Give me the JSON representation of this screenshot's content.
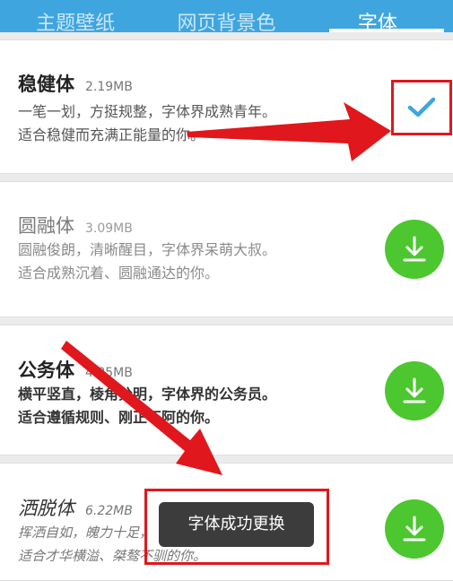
{
  "tabs": [
    {
      "label": "主题壁纸",
      "active": false
    },
    {
      "label": "网页背景色",
      "active": false
    },
    {
      "label": "字体",
      "active": true
    }
  ],
  "fonts": [
    {
      "name": "稳健体",
      "size": "2.19MB",
      "desc1": "一笔一划，方挺规整，字体界成熟青年。",
      "desc2": "适合稳健而充满正能量的你。",
      "status": "selected"
    },
    {
      "name": "圆融体",
      "size": "3.09MB",
      "desc1": "圆融俊朗，清晰醒目，字体界呆萌大叔。",
      "desc2": "适合成熟沉着、圆融通达的你。",
      "status": "download"
    },
    {
      "name": "公务体",
      "size": "4.85MB",
      "desc1": "横平竖直，棱角分明，字体界的公务员。",
      "desc2": "适合遵循规则、刚正不阿的你。",
      "status": "download"
    },
    {
      "name": "洒脱体",
      "size": "6.22MB",
      "desc1": "挥洒自如，魄力十足，",
      "desc2": "适合才华横溢、桀骜不驯的你。",
      "status": "download"
    }
  ],
  "toast": {
    "text": "字体成功更换"
  },
  "colors": {
    "tab_bar": "#3fa5de",
    "download_green": "#4cc72f",
    "check_blue": "#3fa5de",
    "annotation_red": "#e0171c",
    "toast_bg": "#3c3c3c"
  },
  "icons": {
    "selected": "check-icon",
    "download": "download-icon"
  }
}
